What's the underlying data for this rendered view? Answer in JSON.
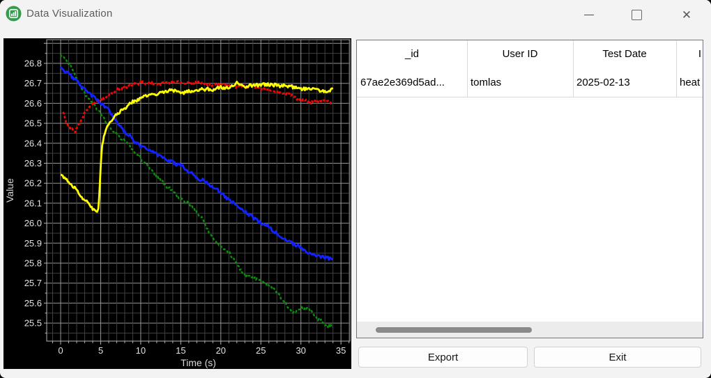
{
  "window": {
    "title": "Data Visualization"
  },
  "titlebar": {
    "app_icon": "bar-chart-icon",
    "controls": [
      "minimize",
      "maximize",
      "close"
    ]
  },
  "chart_data": {
    "type": "line",
    "title": "",
    "xlabel": "Time (s)",
    "ylabel": "Value",
    "xlim": [
      -1.7,
      36.1
    ],
    "ylim": [
      25.41,
      26.92
    ],
    "x_ticks": [
      0,
      5,
      10,
      15,
      20,
      25,
      30,
      35
    ],
    "y_ticks": [
      26.8,
      26.7,
      26.6,
      26.5,
      26.4,
      26.3,
      26.2,
      26.1,
      26.0,
      25.9,
      25.8,
      25.7,
      25.6,
      25.5
    ],
    "grid": true,
    "legend": "none",
    "plot_background": "#000000",
    "series": [
      {
        "name": "red-series",
        "color": "#ff0000",
        "line_style": "dashed",
        "keypoints": [
          [
            0.3,
            26.55
          ],
          [
            0.8,
            26.5
          ],
          [
            1.3,
            26.47
          ],
          [
            1.8,
            26.46
          ],
          [
            2.3,
            26.49
          ],
          [
            2.8,
            26.54
          ],
          [
            3.3,
            26.57
          ],
          [
            4,
            26.6
          ],
          [
            5,
            26.63
          ],
          [
            6,
            26.65
          ],
          [
            7,
            26.67
          ],
          [
            8,
            26.68
          ],
          [
            9,
            26.69
          ],
          [
            10,
            26.7
          ],
          [
            12,
            26.7
          ],
          [
            14,
            26.71
          ],
          [
            16,
            26.71
          ],
          [
            18,
            26.7
          ],
          [
            20,
            26.7
          ],
          [
            22,
            26.69
          ],
          [
            23,
            26.69
          ],
          [
            24,
            26.68
          ],
          [
            25,
            26.67
          ],
          [
            26,
            26.66
          ],
          [
            27,
            26.65
          ],
          [
            28,
            26.64
          ],
          [
            29,
            26.63
          ],
          [
            30,
            26.62
          ],
          [
            31,
            26.61
          ],
          [
            32,
            26.6
          ],
          [
            33,
            26.6
          ],
          [
            34,
            26.59
          ]
        ]
      },
      {
        "name": "green-series",
        "color": "#0a8f0a",
        "line_style": "dashed",
        "keypoints": [
          [
            0,
            26.84
          ],
          [
            1,
            26.8
          ],
          [
            2,
            26.73
          ],
          [
            3,
            26.66
          ],
          [
            4,
            26.61
          ],
          [
            5,
            26.56
          ],
          [
            6,
            26.5
          ],
          [
            7,
            26.45
          ],
          [
            8,
            26.42
          ],
          [
            9,
            26.37
          ],
          [
            10,
            26.33
          ],
          [
            11,
            26.29
          ],
          [
            12,
            26.24
          ],
          [
            13,
            26.2
          ],
          [
            14,
            26.17
          ],
          [
            15,
            26.13
          ],
          [
            16,
            26.11
          ],
          [
            17,
            26.07
          ],
          [
            18,
            26.01
          ],
          [
            19,
            25.93
          ],
          [
            20,
            25.89
          ],
          [
            21,
            25.86
          ],
          [
            22,
            25.8
          ],
          [
            23,
            25.74
          ],
          [
            24,
            25.72
          ],
          [
            25,
            25.71
          ],
          [
            26,
            25.69
          ],
          [
            27,
            25.66
          ],
          [
            28,
            25.61
          ],
          [
            29,
            25.57
          ],
          [
            30,
            25.58
          ],
          [
            31,
            25.57
          ],
          [
            32,
            25.53
          ],
          [
            33,
            25.5
          ],
          [
            34,
            25.49
          ]
        ]
      },
      {
        "name": "blue-series",
        "color": "#1122ff",
        "line_style": "solid",
        "keypoints": [
          [
            0,
            26.78
          ],
          [
            1,
            26.74
          ],
          [
            2,
            26.7
          ],
          [
            3,
            26.66
          ],
          [
            4,
            26.63
          ],
          [
            5,
            26.6
          ],
          [
            6,
            26.56
          ],
          [
            7,
            26.51
          ],
          [
            8,
            26.46
          ],
          [
            9,
            26.42
          ],
          [
            10,
            26.38
          ],
          [
            11,
            26.36
          ],
          [
            12,
            26.34
          ],
          [
            13,
            26.32
          ],
          [
            14,
            26.3
          ],
          [
            15,
            26.28
          ],
          [
            16,
            26.25
          ],
          [
            17,
            26.23
          ],
          [
            18,
            26.21
          ],
          [
            19,
            26.18
          ],
          [
            20,
            26.16
          ],
          [
            21,
            26.13
          ],
          [
            22,
            26.1
          ],
          [
            23,
            26.07
          ],
          [
            24,
            26.04
          ],
          [
            25,
            26.0
          ],
          [
            26,
            25.98
          ],
          [
            27,
            25.95
          ],
          [
            28,
            25.92
          ],
          [
            29,
            25.9
          ],
          [
            30,
            25.88
          ],
          [
            31,
            25.86
          ],
          [
            32,
            25.85
          ],
          [
            33,
            25.84
          ],
          [
            34,
            25.83
          ]
        ]
      },
      {
        "name": "yellow-series",
        "color": "#ffff00",
        "line_style": "solid",
        "keypoints": [
          [
            0,
            26.24
          ],
          [
            0.5,
            26.22
          ],
          [
            1,
            26.2
          ],
          [
            1.5,
            26.18
          ],
          [
            2,
            26.16
          ],
          [
            2.5,
            26.13
          ],
          [
            3,
            26.11
          ],
          [
            3.5,
            26.09
          ],
          [
            4,
            26.07
          ],
          [
            4.4,
            26.05
          ],
          [
            4.7,
            26.06
          ],
          [
            4.9,
            26.2
          ],
          [
            5.1,
            26.35
          ],
          [
            5.4,
            26.44
          ],
          [
            6,
            26.5
          ],
          [
            7,
            26.55
          ],
          [
            8,
            26.58
          ],
          [
            9,
            26.6
          ],
          [
            10,
            26.62
          ],
          [
            11,
            26.63
          ],
          [
            12,
            26.64
          ],
          [
            13,
            26.65
          ],
          [
            14,
            26.66
          ],
          [
            15,
            26.66
          ],
          [
            16,
            26.67
          ],
          [
            17,
            26.67
          ],
          [
            18,
            26.68
          ],
          [
            19,
            26.68
          ],
          [
            20,
            26.69
          ],
          [
            21,
            26.69
          ],
          [
            22,
            26.7
          ],
          [
            23,
            26.69
          ],
          [
            24,
            26.69
          ],
          [
            25,
            26.69
          ],
          [
            26,
            26.68
          ],
          [
            27,
            26.68
          ],
          [
            28,
            26.68
          ],
          [
            29,
            26.67
          ],
          [
            30,
            26.66
          ],
          [
            31,
            26.67
          ],
          [
            32,
            26.67
          ],
          [
            33,
            26.66
          ],
          [
            34,
            26.67
          ]
        ]
      }
    ]
  },
  "table": {
    "columns": [
      "_id",
      "User ID",
      "Test Date",
      "I"
    ],
    "rows": [
      [
        "67ae2e369d5ad...",
        "tomlas",
        "2025-02-13",
        "heat"
      ]
    ]
  },
  "footer": {
    "export_label": "Export",
    "exit_label": "Exit"
  }
}
